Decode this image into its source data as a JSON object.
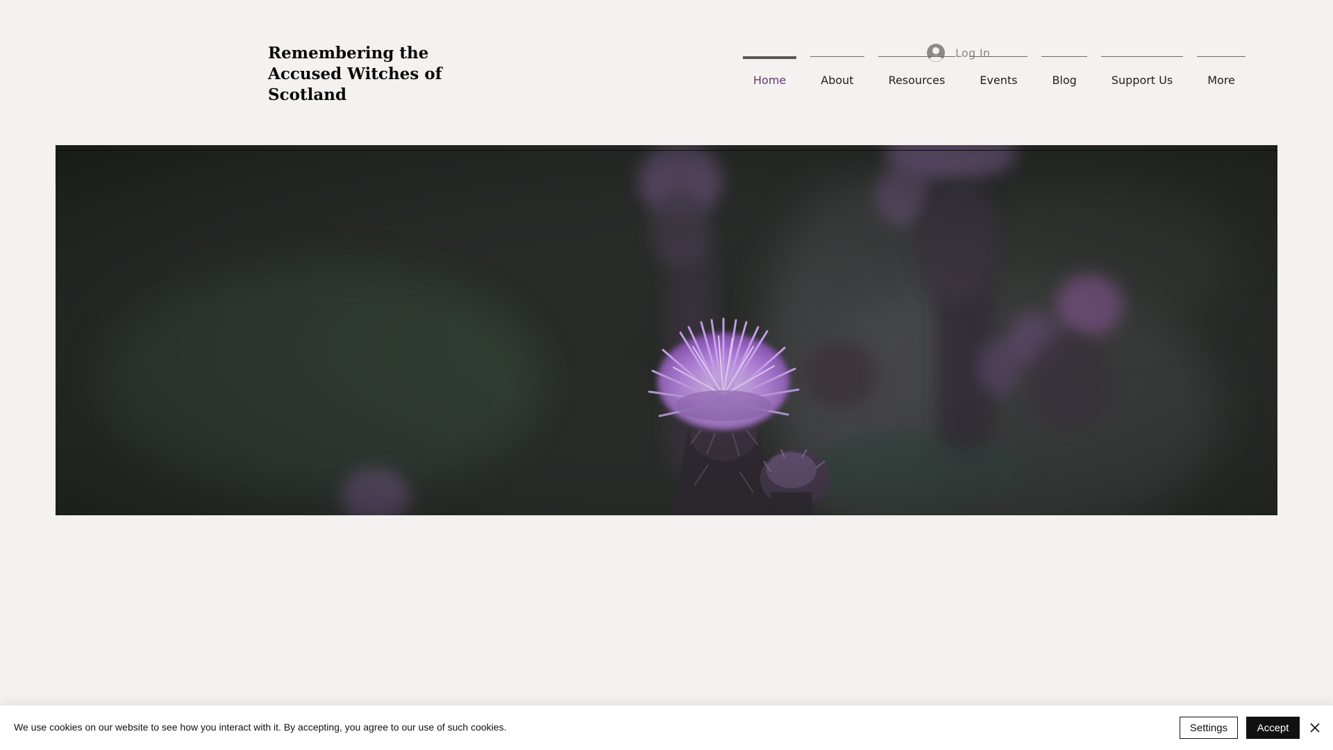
{
  "header": {
    "site_title": "Remembering the Accused Witches of Scotland",
    "login": {
      "label": "Log In",
      "icon": "user-avatar-icon"
    },
    "nav": [
      {
        "label": "Home",
        "active": true
      },
      {
        "label": "About",
        "active": false
      },
      {
        "label": "Resources",
        "active": false
      },
      {
        "label": "Events",
        "active": false
      },
      {
        "label": "Blog",
        "active": false
      },
      {
        "label": "Support Us",
        "active": false
      },
      {
        "label": "More",
        "active": false
      }
    ]
  },
  "hero": {
    "image": "purple-thistle-flowers-photo"
  },
  "cookie_banner": {
    "message": "We use cookies on our website to see how you interact with it. By accepting, you agree to our use of such cookies.",
    "settings_label": "Settings",
    "accept_label": "Accept",
    "close_icon": "close-icon"
  },
  "colors": {
    "page_background": "#f4f1f0",
    "active_nav_text": "#5d3a72",
    "thistle_purple": "#b07ed8",
    "accept_button": "#111111"
  }
}
